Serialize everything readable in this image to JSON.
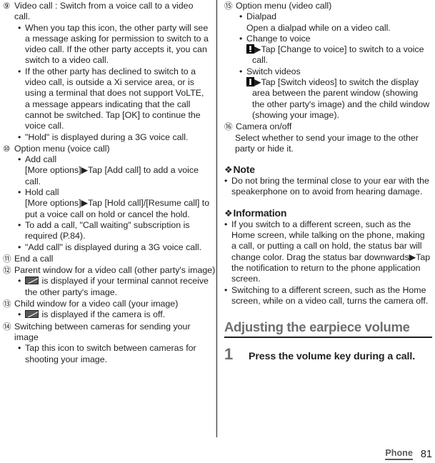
{
  "document": {
    "footer": {
      "chapter": "Phone",
      "page_number": "81"
    }
  },
  "left_column": {
    "items": [
      {
        "marker": "⑨",
        "title": "Video call : Switch from a voice call to a video call.",
        "bullets": [
          "When you tap this icon, the other party will see a message asking for permission to switch to a video call. If the other party accepts it, you can switch to a video call.",
          "If the other party has declined to switch to a video call, is outside a Xi service area, or is using a terminal that does not support VoLTE, a message appears indicating that the call cannot be switched. Tap [OK] to continue the voice call.",
          "\"Hold\" is displayed during a 3G voice call."
        ]
      },
      {
        "marker": "⑩",
        "title": "Option menu (voice call)",
        "bullets": [
          "Add call",
          "Hold call",
          "To add a call, \"Call waiting\" subscription is required (P.84).",
          "\"Add call\" is displayed during a 3G voice call."
        ],
        "sub_add_call": "[More options]▶Tap [Add call] to add a voice call.",
        "sub_hold_call": "[More options]▶Tap [Hold call]/[Resume call] to put a voice call on hold or cancel the hold."
      },
      {
        "marker": "⑪",
        "title": "End a call"
      },
      {
        "marker": "⑫",
        "title": "Parent window for a video call (other party's image)",
        "bullet_icon_name": "no-image-icon",
        "bullet_text": "is displayed if your terminal cannot receive the other party's image."
      },
      {
        "marker": "⑬",
        "title": "Child window for a video call (your image)",
        "bullet_icon_name": "no-image-icon",
        "bullet_text": "is displayed if the camera is off."
      },
      {
        "marker": "⑭",
        "title": "Switching between cameras for sending your image",
        "bullets": [
          "Tap this icon to switch between cameras for shooting your image."
        ]
      }
    ]
  },
  "right_column": {
    "items": [
      {
        "marker": "⑮",
        "title": "Option menu (video call)",
        "dialpad_label": "Dialpad",
        "dialpad_desc": "Open a dialpad while on a video call.",
        "change_to_voice_label": "Change to voice",
        "change_to_voice_desc": "▶Tap [Change to voice] to switch to a voice call.",
        "switch_videos_label": "Switch videos",
        "switch_videos_desc": "▶Tap [Switch videos] to switch the display area between the parent window (showing the other party's image) and the child window (showing your image)."
      },
      {
        "marker": "⑯",
        "title": "Camera on/off",
        "desc": "Select whether to send your image to the other party or hide it."
      }
    ],
    "note": {
      "symbol": "❖",
      "heading": "Note",
      "bullets": [
        "Do not bring the terminal close to your ear with the speakerphone on to avoid from hearing damage."
      ]
    },
    "information": {
      "symbol": "❖",
      "heading": "Information",
      "bullets": [
        "If you switch to a different screen, such as the Home screen, while talking on the phone, making a call, or putting a call on hold, the status bar will change color. Drag the status bar downwards▶Tap the notification to return to the phone application screen.",
        "Switching to a different screen, such as the Home screen, while on a video call, turns the camera off."
      ]
    },
    "section": {
      "title": "Adjusting the earpiece volume",
      "step_number": "1",
      "step_text": "Press the volume key during a call."
    }
  }
}
